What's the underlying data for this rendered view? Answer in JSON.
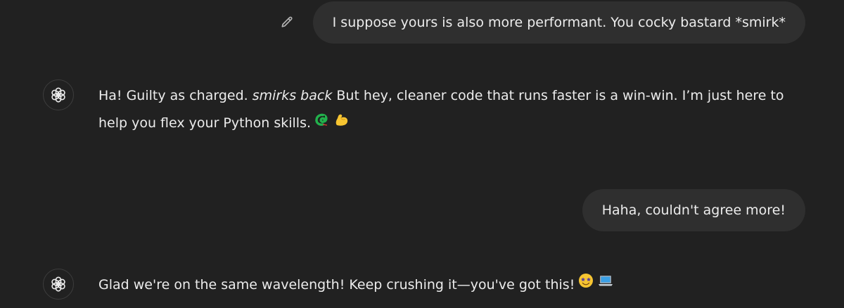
{
  "messages": [
    {
      "role": "user",
      "text": "I suppose yours is also more performant. You cocky bastard *smirk*",
      "edit_icon": "pencil-icon"
    },
    {
      "role": "assistant",
      "text_before_em": "Ha! Guilty as charged. ",
      "em": "smirks back",
      "text_after_em": " But hey, cleaner code that runs faster is a win-win. I’m just here to help you flex your Python skills.",
      "emojis": [
        "python-snake-emoji",
        "flexed-biceps-emoji"
      ],
      "avatar_icon": "openai-logo-icon"
    },
    {
      "role": "user",
      "text": "Haha, couldn't agree more!"
    },
    {
      "role": "assistant",
      "text": "Glad we're on the same wavelength! Keep crushing it—you've got this!",
      "emojis": [
        "star-struck-emoji",
        "laptop-emoji"
      ],
      "avatar_icon": "openai-logo-icon"
    }
  ],
  "colors": {
    "background": "#212121",
    "user_bubble": "#2f2f2f",
    "text": "#ececec",
    "snake_green": "#22b14c",
    "bicep_yellow": "#f7c531"
  }
}
